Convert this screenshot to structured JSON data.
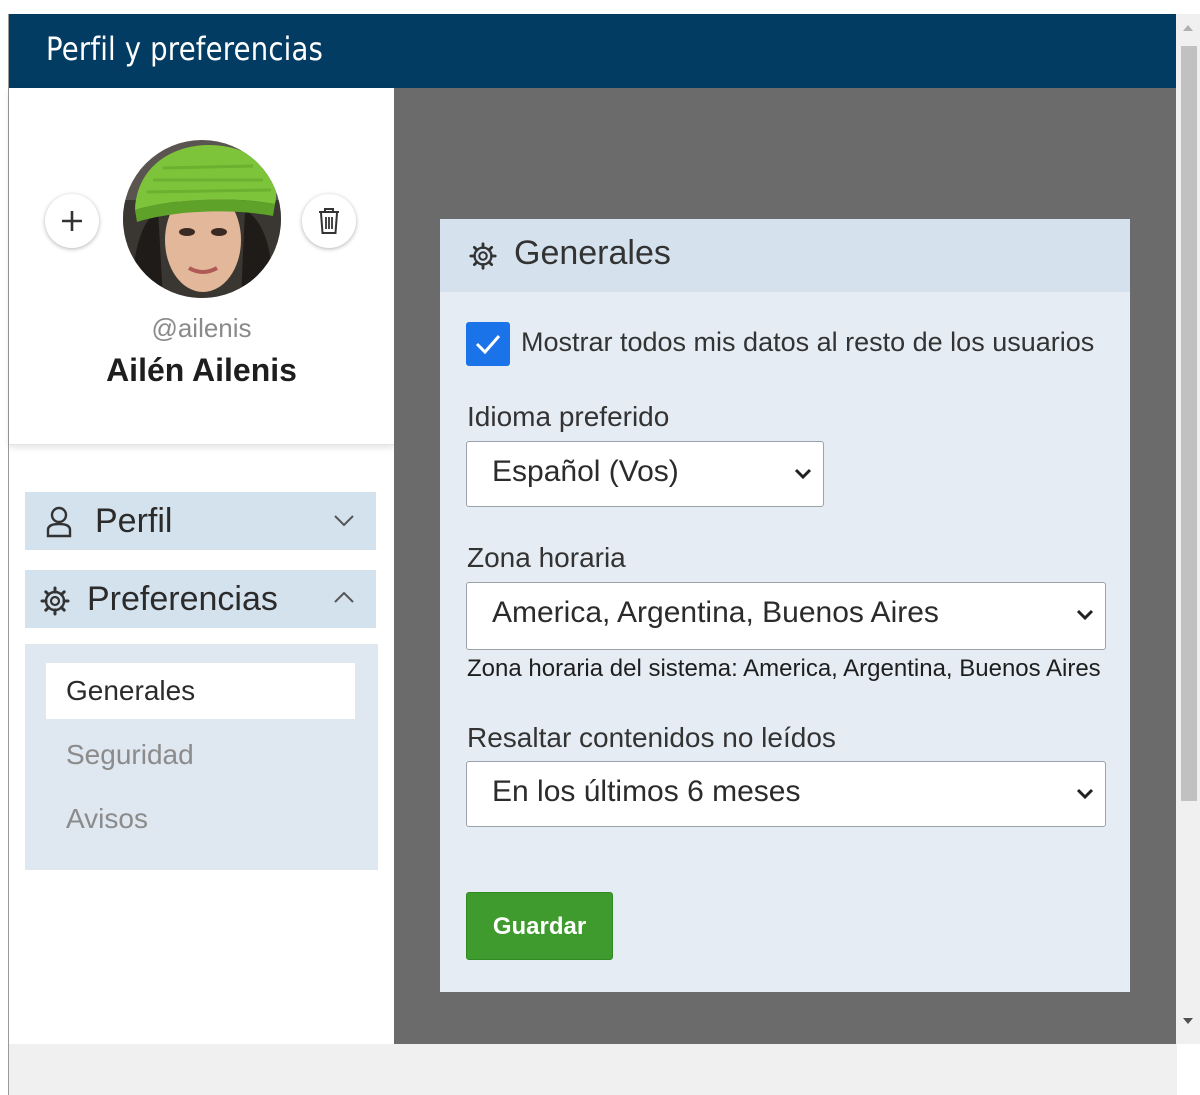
{
  "window": {
    "title": "Perfil y preferencias"
  },
  "colors": {
    "titlebar": "#023c63",
    "content_bg": "#6b6b6b",
    "panel_bg": "#e6ecf3",
    "panel_header_bg": "#d5e2ed",
    "nav_item_bg": "#d4e2ee",
    "checkbox": "#1a73e8",
    "save_button": "#3f9b2e"
  },
  "profile": {
    "username": "@ailenis",
    "full_name": "Ailén Ailenis",
    "add_icon": "plus-icon",
    "delete_icon": "trash-icon"
  },
  "sidebar": {
    "items": [
      {
        "label": "Perfil",
        "icon": "user-icon",
        "expanded": false
      },
      {
        "label": "Preferencias",
        "icon": "gear-icon",
        "expanded": true
      }
    ],
    "subitems": [
      {
        "label": "Generales",
        "active": true
      },
      {
        "label": "Seguridad",
        "active": false
      },
      {
        "label": "Avisos",
        "active": false
      }
    ]
  },
  "panel": {
    "title": "Generales",
    "icon": "gear-icon",
    "show_data_checkbox": {
      "label": "Mostrar todos mis datos al resto de los usuarios",
      "checked": true
    },
    "language": {
      "label": "Idioma preferido",
      "value": "Español (Vos)"
    },
    "timezone": {
      "label": "Zona horaria",
      "value": "America, Argentina, Buenos Aires",
      "help": "Zona horaria del sistema: America, Argentina, Buenos Aires"
    },
    "highlight": {
      "label": "Resaltar contenidos no leídos",
      "value": "En los últimos 6 meses"
    },
    "save_label": "Guardar"
  }
}
